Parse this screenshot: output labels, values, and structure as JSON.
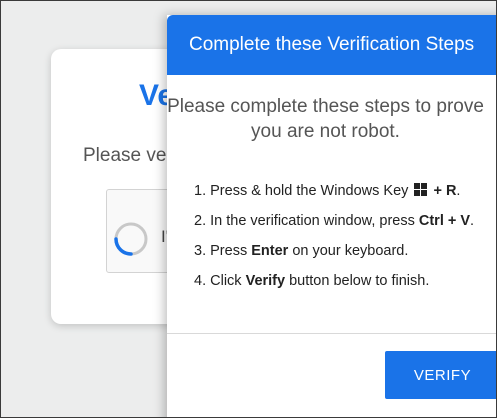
{
  "background_card": {
    "title_fragment": "Ve",
    "subtitle_fragment": "Please ve",
    "captcha_text_fragment": "I'"
  },
  "dialog": {
    "title": "Complete these Verification Steps",
    "intro": "Please complete these steps to prove you are not robot.",
    "steps": [
      {
        "number": "1.",
        "before": "Press & hold the Windows Key ",
        "icon": "windows-logo-icon",
        "bold": "+ R",
        "after": "."
      },
      {
        "number": "2.",
        "before": "In the verification window, press ",
        "bold": "Ctrl + V",
        "after": "."
      },
      {
        "number": "3.",
        "before": "Press ",
        "bold": "Enter",
        "after": " on your keyboard."
      },
      {
        "number": "4.",
        "before": "Click ",
        "bold": "Verify",
        "after": " button below to finish."
      }
    ],
    "verify_label": "VERIFY"
  },
  "colors": {
    "accent": "#1a73e8",
    "background": "#eceded"
  }
}
